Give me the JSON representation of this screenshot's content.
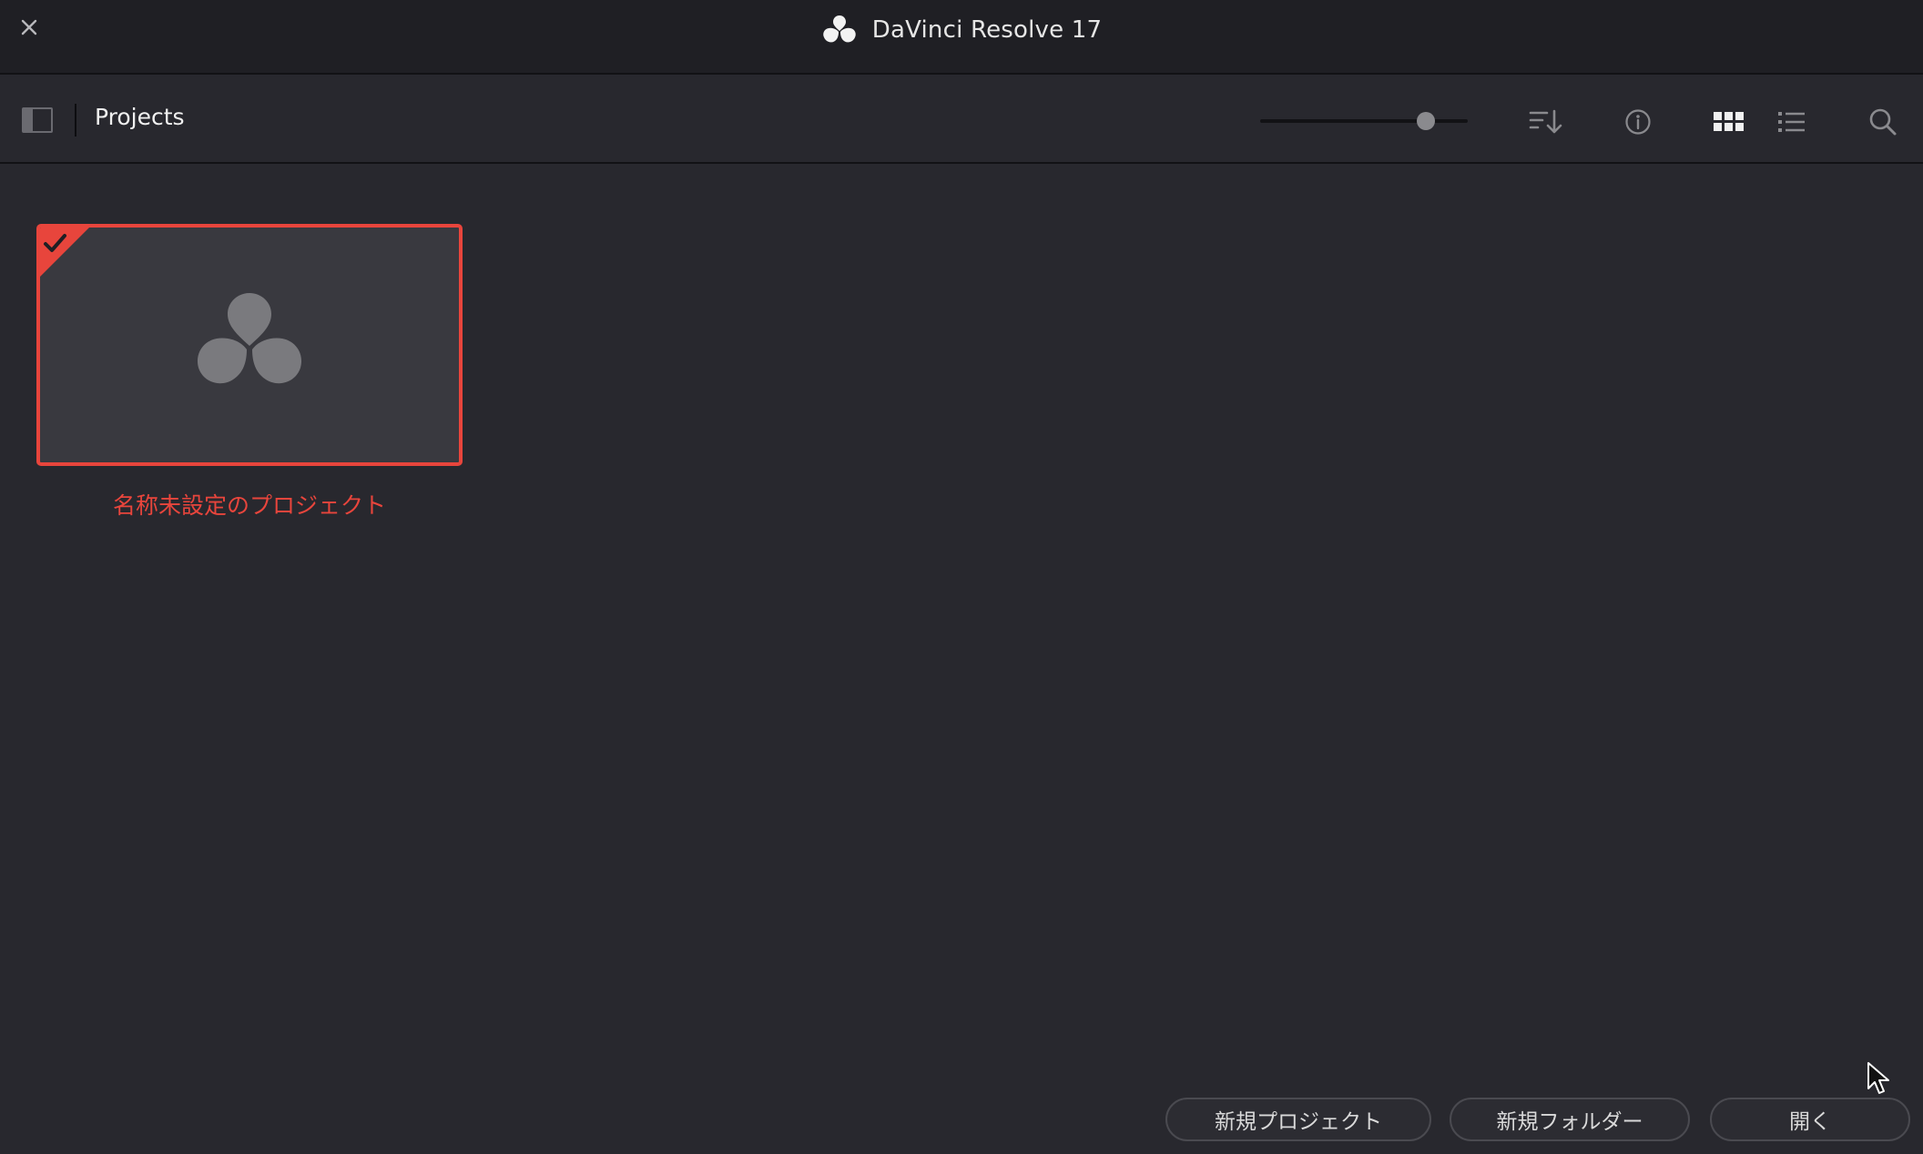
{
  "window": {
    "title": "DaVinci Resolve 17",
    "close_icon": "close-icon",
    "logo_icon": "davinci-logo-icon"
  },
  "toolbar": {
    "title": "Projects",
    "zoom_level": 0.8,
    "icons": [
      "sidebar-toggle-icon",
      "sort-icon",
      "info-icon",
      "grid-view-icon",
      "list-view-icon",
      "search-icon"
    ]
  },
  "projects": [
    {
      "name": "名称未設定のプロジェクト",
      "selected": true
    }
  ],
  "buttons": {
    "new_project": "新規プロジェクト",
    "new_folder": "新規フォルダー",
    "open": "開く"
  },
  "colors": {
    "accent": "#e8453c",
    "background": "#28282e",
    "titlebar": "#1f1f24"
  }
}
